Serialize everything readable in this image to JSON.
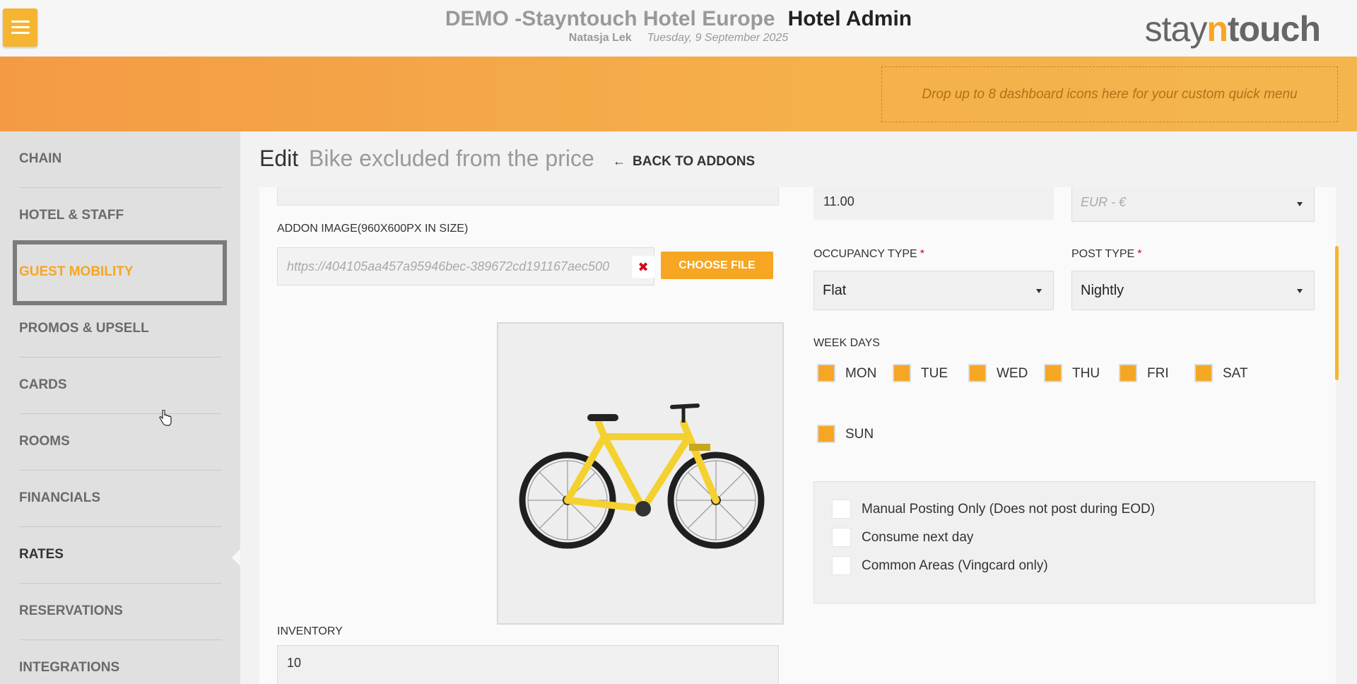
{
  "header": {
    "hotel_name": "DEMO -Stayntouch Hotel Europe",
    "app_name": "Hotel Admin",
    "user": "Natasja Lek",
    "date": "Tuesday, 9 September 2025",
    "logo_pre": "stay",
    "logo_n": "n",
    "logo_post": "touch"
  },
  "quick_menu": {
    "placeholder": "Drop up to 8 dashboard icons here for your custom quick menu"
  },
  "sidebar": {
    "items": [
      {
        "label": "CHAIN"
      },
      {
        "label": "HOTEL & STAFF"
      },
      {
        "label": "GUEST MOBILITY"
      },
      {
        "label": "PROMOS & UPSELL"
      },
      {
        "label": "CARDS"
      },
      {
        "label": "ROOMS"
      },
      {
        "label": "FINANCIALS"
      },
      {
        "label": "RATES"
      },
      {
        "label": "RESERVATIONS"
      },
      {
        "label": "INTEGRATIONS"
      }
    ]
  },
  "page": {
    "edit_label": "Edit",
    "addon_name": "Bike excluded from the price",
    "back_label": "BACK TO ADDONS"
  },
  "form": {
    "addon_image_label": "ADDON IMAGE(960X600PX IN SIZE)",
    "image_url": "https://404105aa457a95946bec-389672cd191167aec500",
    "choose_file_label": "CHOOSE FILE",
    "inventory_label": "INVENTORY",
    "inventory_value": "10",
    "price_value": "11.00",
    "currency_value": "EUR - €",
    "occupancy_type_label": "OCCUPANCY TYPE",
    "occupancy_type_value": "Flat",
    "post_type_label": "POST TYPE",
    "post_type_value": "Nightly",
    "required_mark": "*",
    "week_days_label": "WEEK DAYS",
    "week_days": [
      "MON",
      "TUE",
      "WED",
      "THU",
      "FRI",
      "SAT",
      "SUN"
    ],
    "options": [
      {
        "label": "Manual Posting Only (Does not post during EOD)"
      },
      {
        "label": "Consume next day"
      },
      {
        "label": "Common Areas (Vingcard only)"
      }
    ]
  },
  "colors": {
    "accent": "#f6a623",
    "required": "#d0021b",
    "bike_frame": "#f5d130"
  },
  "icons": {
    "menu": "hamburger-icon",
    "back": "arrow-left-icon",
    "remove": "close-icon",
    "cursor": "hand-pointer-icon"
  }
}
